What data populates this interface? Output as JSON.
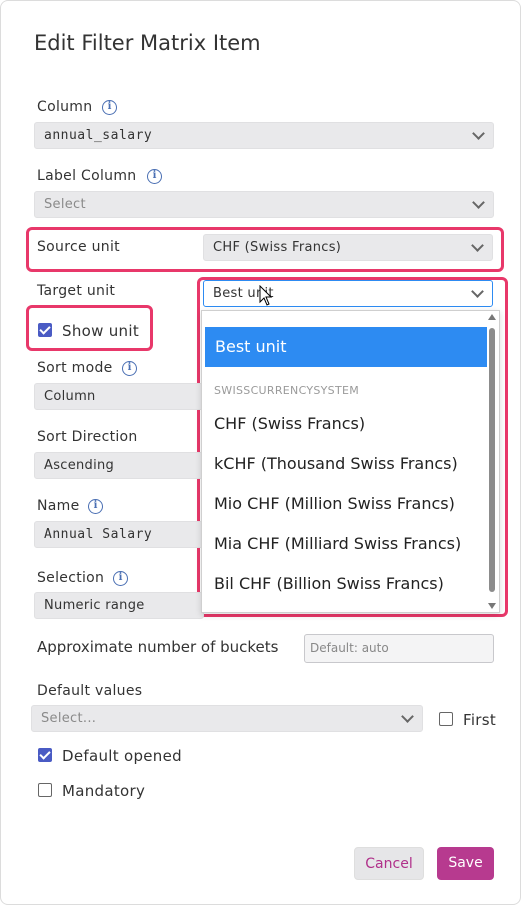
{
  "dialog": {
    "title": "Edit Filter Matrix Item"
  },
  "fields": {
    "column": {
      "label": "Column",
      "value": "annual_salary"
    },
    "label_column": {
      "label": "Label Column",
      "placeholder": "Select"
    },
    "source_unit": {
      "label": "Source unit",
      "value": "CHF (Swiss Francs)"
    },
    "target_unit": {
      "label": "Target unit",
      "value": "Best unit"
    },
    "show_unit": {
      "label": "Show unit",
      "checked": true
    },
    "sort_mode": {
      "label": "Sort mode",
      "value": "Column"
    },
    "sort_direction": {
      "label": "Sort Direction",
      "value": "Ascending"
    },
    "name": {
      "label": "Name",
      "value": "Annual Salary"
    },
    "selection": {
      "label": "Selection",
      "value": "Numeric range"
    },
    "buckets": {
      "label": "Approximate number of buckets",
      "placeholder": "Default: auto"
    },
    "default_values": {
      "label": "Default values",
      "placeholder": "Select..."
    },
    "first": {
      "label": "First",
      "checked": false
    },
    "default_opened": {
      "label": "Default opened",
      "checked": true
    },
    "mandatory": {
      "label": "Mandatory",
      "checked": false
    }
  },
  "dropdown": {
    "selected": "Best unit",
    "group_label": "SWISSCURRENCYSYSTEM",
    "options": [
      "CHF (Swiss Francs)",
      "kCHF (Thousand Swiss Francs)",
      "Mio CHF (Million Swiss Francs)",
      "Mia CHF (Milliard Swiss Francs)",
      "Bil CHF (Billion Swiss Francs)"
    ]
  },
  "buttons": {
    "cancel": "Cancel",
    "save": "Save"
  },
  "icons": {
    "info": "i"
  },
  "colors": {
    "highlight": "#e8386a",
    "accent": "#b73a8f",
    "selected_option": "#2d8bf2",
    "checkbox": "#4a5bc4"
  }
}
